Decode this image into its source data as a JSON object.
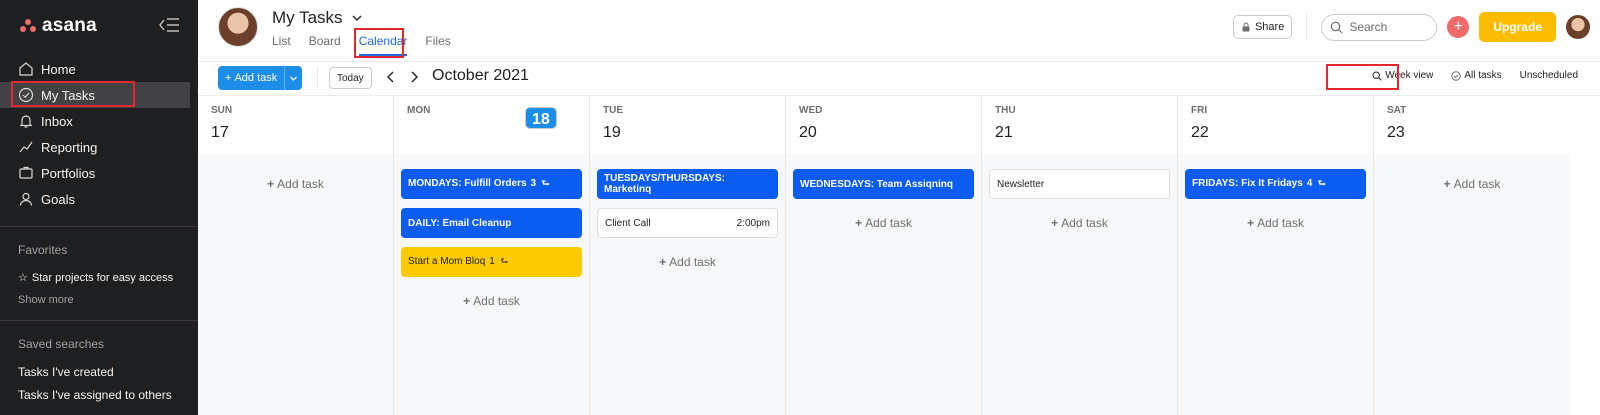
{
  "sidebar": {
    "brand": "asana",
    "nav": [
      {
        "label": "Home",
        "icon": "home-icon"
      },
      {
        "label": "My Tasks",
        "icon": "check-circle-icon"
      },
      {
        "label": "Inbox",
        "icon": "bell-icon"
      },
      {
        "label": "Reporting",
        "icon": "chart-line-icon"
      },
      {
        "label": "Portfolios",
        "icon": "portfolio-icon"
      },
      {
        "label": "Goals",
        "icon": "person-icon"
      }
    ],
    "favorites_heading": "Favorites",
    "favorites_hint": "Star projects for easy access",
    "show_more": "Show more",
    "saved_heading": "Saved searches",
    "saved": [
      "Tasks I've created",
      "Tasks I've assigned to others"
    ]
  },
  "header": {
    "title": "My Tasks",
    "tabs": [
      "List",
      "Board",
      "Calendar",
      "Files"
    ],
    "active_tab": "Calendar",
    "share": "Share",
    "search_placeholder": "Search",
    "upgrade": "Upgrade"
  },
  "toolbar": {
    "add_task": "Add task",
    "today": "Today",
    "month": "October 2021",
    "week_view": "Week view",
    "all_tasks": "All tasks",
    "unscheduled": "Unscheduled"
  },
  "calendar": {
    "add_task_label": "Add task",
    "days": [
      {
        "name": "SUN",
        "num": "17",
        "today": false,
        "tasks": []
      },
      {
        "name": "MON",
        "num": "18",
        "today": true,
        "tasks": [
          {
            "label": "MONDAYS: Fulfill Orders",
            "count": "3",
            "style": "blue",
            "subtask": true
          },
          {
            "label": "DAILY: Email Cleanup",
            "count": "",
            "style": "blue",
            "subtask": false
          },
          {
            "label": "Start a Mom Bloq",
            "count": "1",
            "style": "yellow",
            "subtask": true
          }
        ]
      },
      {
        "name": "TUE",
        "num": "19",
        "today": false,
        "tasks": [
          {
            "label": "TUESDAYS/THURSDAYS: Marketinq",
            "count": "",
            "style": "blue",
            "subtask": false
          },
          {
            "label": "Client Call",
            "time": "2:00pm",
            "style": "white",
            "subtask": false
          }
        ]
      },
      {
        "name": "WED",
        "num": "20",
        "today": false,
        "tasks": [
          {
            "label": "WEDNESDAYS: Team Assiqninq",
            "count": "",
            "style": "blue",
            "subtask": false
          }
        ]
      },
      {
        "name": "THU",
        "num": "21",
        "today": false,
        "tasks": [
          {
            "label": "Newsletter",
            "count": "",
            "style": "white",
            "subtask": false
          }
        ]
      },
      {
        "name": "FRI",
        "num": "22",
        "today": false,
        "tasks": [
          {
            "label": "FRIDAYS: Fix It Fridays",
            "count": "4",
            "style": "blue",
            "subtask": true
          }
        ]
      },
      {
        "name": "SAT",
        "num": "23",
        "today": false,
        "tasks": []
      }
    ]
  },
  "colors": {
    "sidebar_bg": "#1e1f21",
    "accent_blue": "#1c8eea",
    "task_blue": "#0b5cf0",
    "task_yellow": "#fcca01",
    "upgrade": "#fcbd01",
    "highlight_box": "#e0282e"
  }
}
